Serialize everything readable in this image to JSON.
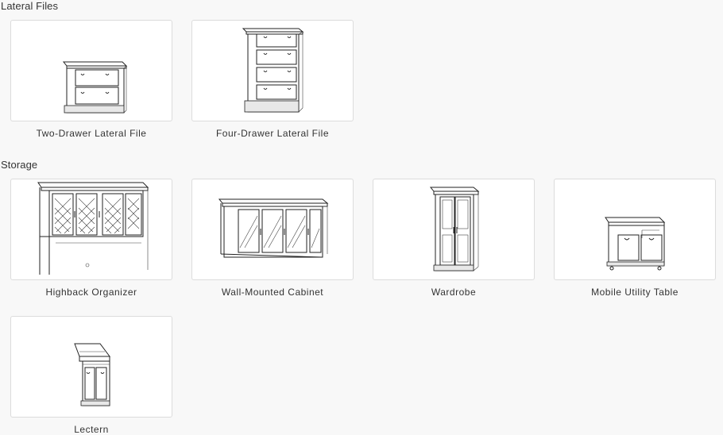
{
  "sections": [
    {
      "title": "Lateral Files",
      "items": [
        {
          "label": "Two-Drawer Lateral File",
          "icon": "two-drawer-lateral-file-icon"
        },
        {
          "label": "Four-Drawer Lateral File",
          "icon": "four-drawer-lateral-file-icon"
        }
      ]
    },
    {
      "title": "Storage",
      "items": [
        {
          "label": "Highback Organizer",
          "icon": "highback-organizer-icon"
        },
        {
          "label": "Wall-Mounted Cabinet",
          "icon": "wall-mounted-cabinet-icon"
        },
        {
          "label": "Wardrobe",
          "icon": "wardrobe-icon"
        },
        {
          "label": "Mobile Utility Table",
          "icon": "mobile-utility-table-icon"
        },
        {
          "label": "Lectern",
          "icon": "lectern-icon"
        }
      ]
    }
  ]
}
